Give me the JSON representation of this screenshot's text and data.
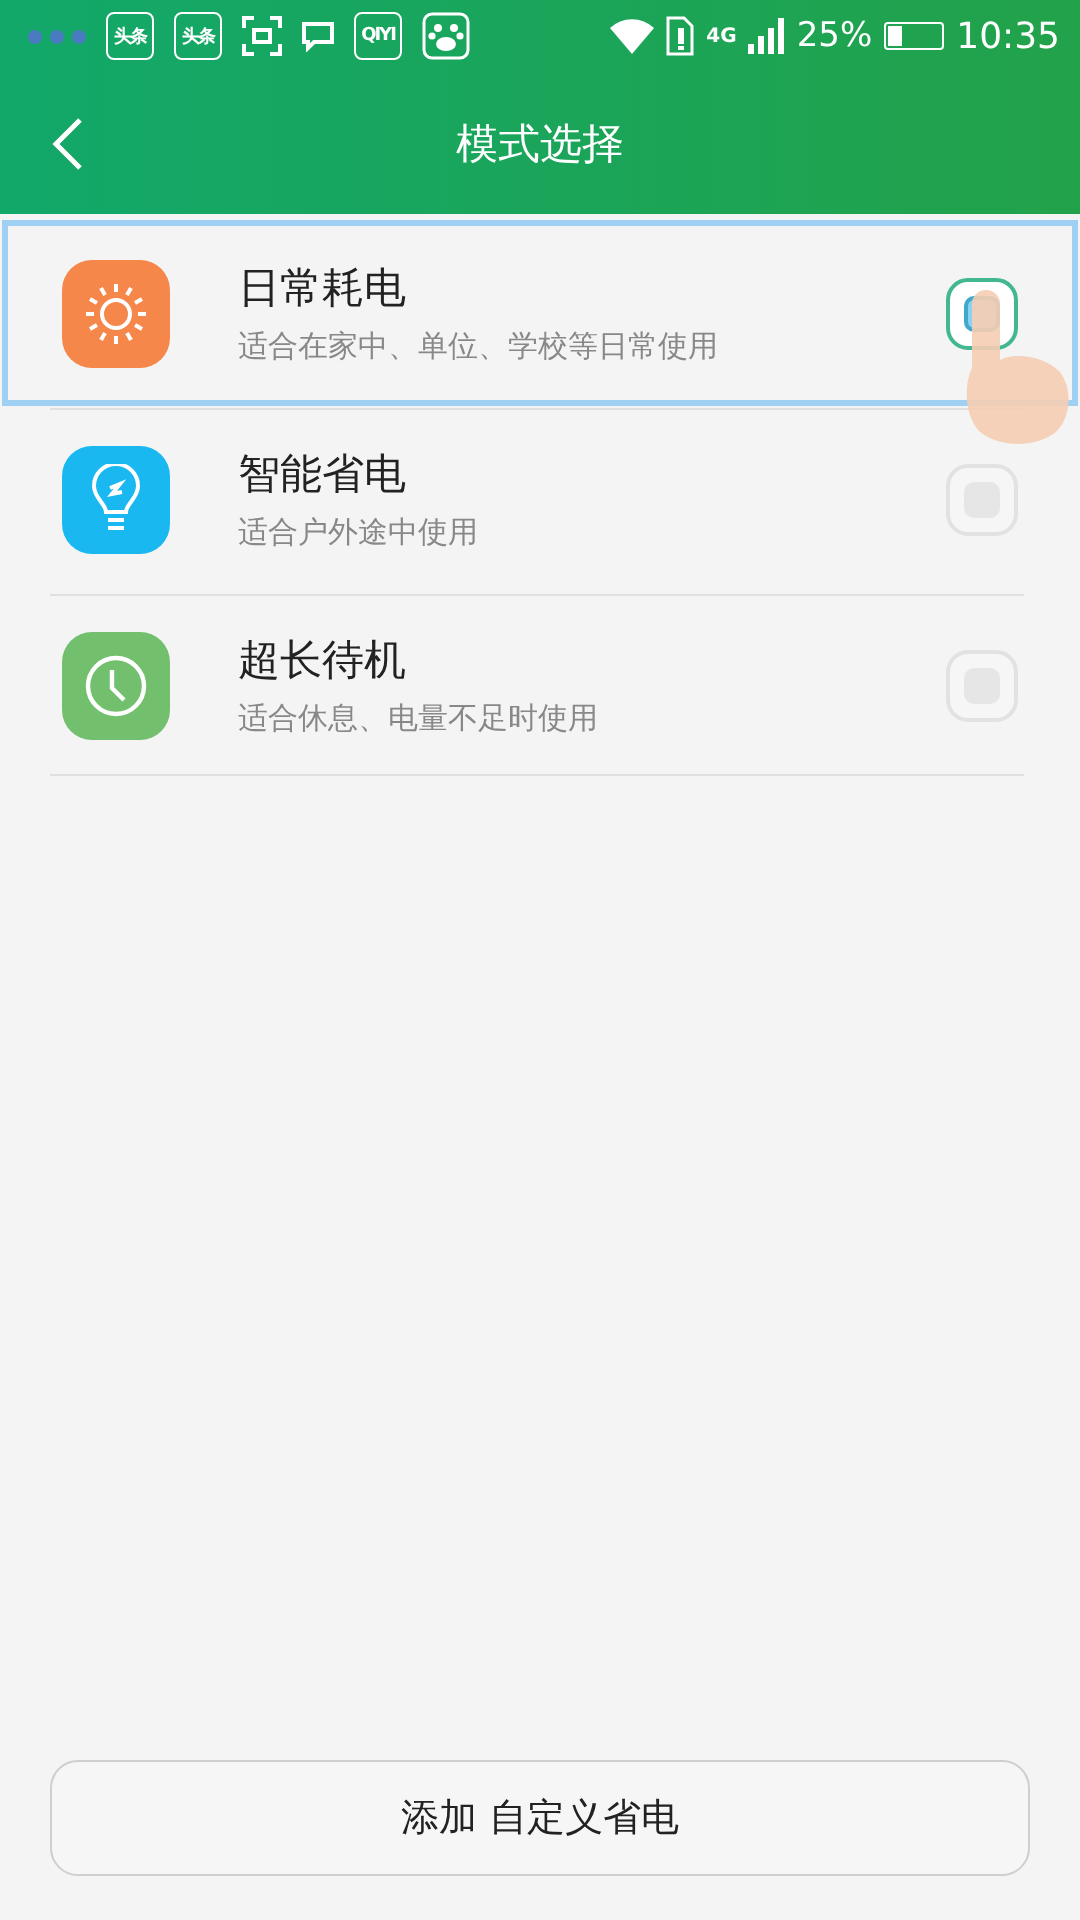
{
  "status_bar": {
    "notification_icons": [
      {
        "kind": "text",
        "label": "头条"
      },
      {
        "kind": "text",
        "label": "头条"
      },
      {
        "kind": "scan"
      },
      {
        "kind": "message"
      },
      {
        "kind": "text",
        "label": "QIYI"
      },
      {
        "kind": "paw"
      }
    ],
    "network": "4G",
    "battery": "25%",
    "time": "10:35"
  },
  "header": {
    "title": "模式选择"
  },
  "modes": [
    {
      "kind": "sun",
      "color": "#f5874a",
      "title": "日常耗电",
      "subtitle": "适合在家中、单位、学校等日常使用",
      "selected": true
    },
    {
      "kind": "bulb",
      "color": "#1ab8f0",
      "title": "智能省电",
      "subtitle": "适合户外途中使用",
      "selected": false
    },
    {
      "kind": "clock",
      "color": "#72c06e",
      "title": "超长待机",
      "subtitle": "适合休息、电量不足时使用",
      "selected": false
    }
  ],
  "add_button": {
    "label": "添加 自定义省电"
  }
}
